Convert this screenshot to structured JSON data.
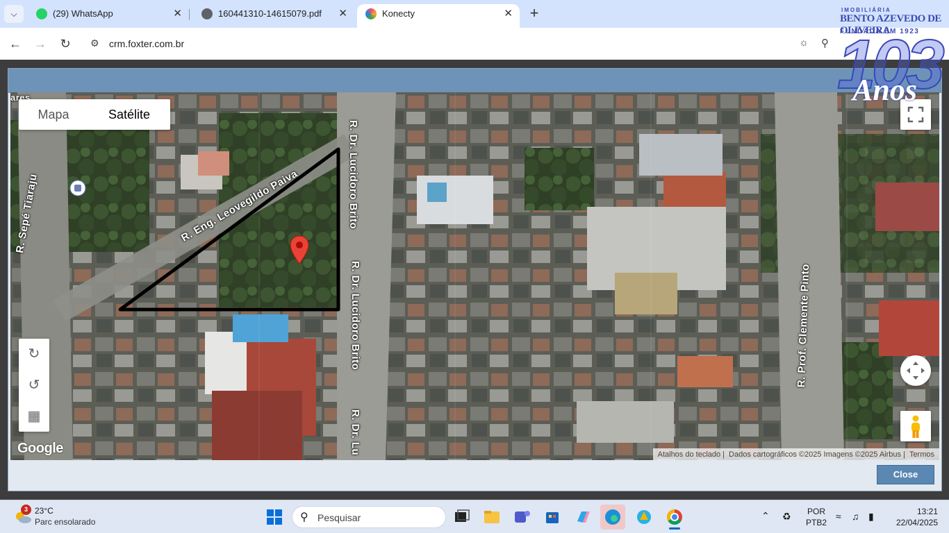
{
  "browser": {
    "tabs": [
      {
        "title": "(29) WhatsApp",
        "icon": "whatsapp-icon"
      },
      {
        "title": "160441310-14615079.pdf",
        "icon": "globe-icon"
      },
      {
        "title": "Konecty",
        "icon": "konecty-icon"
      }
    ],
    "active_tab": 2,
    "url": "crm.foxter.com.br"
  },
  "map": {
    "type_options": [
      "Mapa",
      "Satélite"
    ],
    "selected_type": "Satélite",
    "streets": [
      "R. Sepé Tiaraju",
      "R. Eng. Leovegildo Paiva",
      "R. Dr. Lucidoro Brito",
      "R. Dr. Lucidoro Brito",
      "R. Dr. Lu",
      "R. Prof. Clemente Pinto",
      "ares"
    ],
    "google_logo": "Google",
    "attribution": {
      "shortcuts": "Atalhos do teclado",
      "data": "Dados cartográficos ©2025 Imagens ©2025 Airbus",
      "terms": "Termos"
    }
  },
  "modal": {
    "close_label": "Close"
  },
  "overlay_logo": {
    "line1": "IMOBILIÁRIA",
    "line2": "BENTO AZEVEDO DE OLIVEIRA",
    "line3": "FUNDADA EM 1923",
    "number": "103",
    "word": "Anos"
  },
  "taskbar": {
    "weather_badge": "3",
    "temperature": "23°C",
    "weather_desc": "Parc ensolarado",
    "search_placeholder": "Pesquisar",
    "lang_top": "POR",
    "lang_bottom": "PTB2",
    "time": "13:21",
    "date": "22/04/2025"
  }
}
